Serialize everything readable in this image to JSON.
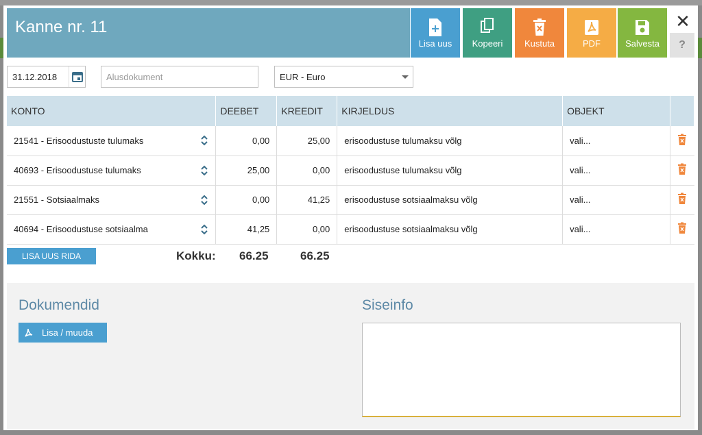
{
  "header": {
    "title": "Kanne nr. 11"
  },
  "toolbar": {
    "new_label": "Lisa uus",
    "copy_label": "Kopeeri",
    "delete_label": "Kustuta",
    "pdf_label": "PDF",
    "save_label": "Salvesta",
    "close_symbol": "✕",
    "help_symbol": "?"
  },
  "form": {
    "date": "31.12.2018",
    "basis_placeholder": "Alusdokument",
    "currency": "EUR - Euro"
  },
  "table": {
    "headers": {
      "account": "KONTO",
      "debit": "DEEBET",
      "credit": "KREEDIT",
      "description": "KIRJELDUS",
      "object": "OBJEKT"
    },
    "rows": [
      {
        "account": "21541 - Erisoodustuste tulumaks",
        "debit": "0,00",
        "credit": "25,00",
        "description": "erisoodustuse tulumaksu võlg",
        "object": "vali..."
      },
      {
        "account": "40693 - Erisoodustuse tulumaks",
        "debit": "25,00",
        "credit": "0,00",
        "description": "erisoodustuse tulumaksu võlg",
        "object": "vali..."
      },
      {
        "account": "21551 - Sotsiaalmaks",
        "debit": "0,00",
        "credit": "41,25",
        "description": "erisoodustuse sotsiaalmaksu võlg",
        "object": "vali..."
      },
      {
        "account": "40694 - Erisoodustuse sotsiaalma",
        "debit": "41,25",
        "credit": "0,00",
        "description": "erisoodustuse sotsiaalmaksu võlg",
        "object": "vali..."
      }
    ]
  },
  "footer": {
    "add_row_label": "LISA UUS RIDA",
    "total_label": "Kokku:",
    "total_debit": "66.25",
    "total_credit": "66.25"
  },
  "documents": {
    "title": "Dokumendid",
    "button_label": "Lisa / muuda"
  },
  "internal_info": {
    "title": "Siseinfo",
    "value": ""
  },
  "colors": {
    "header_bg": "#6fa8be",
    "new_btn": "#4a9fd0",
    "copy_btn": "#3f9f82",
    "delete_btn": "#f0873c",
    "pdf_btn": "#f5ac45",
    "save_btn": "#84b740",
    "row_trash": "#f0873c"
  }
}
